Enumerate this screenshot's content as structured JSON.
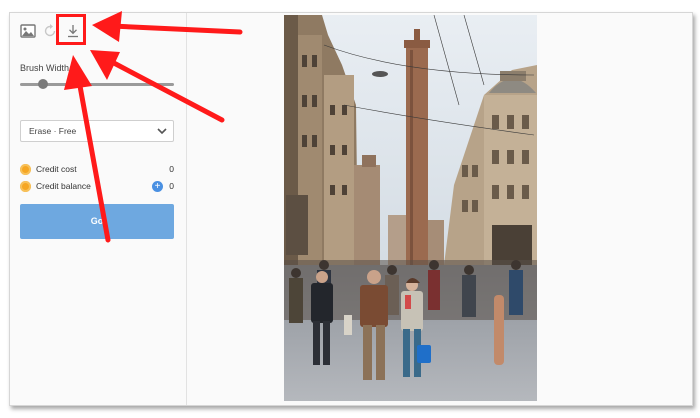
{
  "sidebar": {
    "toolbar": {
      "image_icon": "image-icon",
      "undo_icon": "rotate-icon",
      "download_icon": "download-icon"
    },
    "brush_width_label": "Brush Width",
    "brush_width_level": 0.15,
    "mode_select": {
      "value": "Erase · Free"
    },
    "credits": [
      {
        "label": "Credit cost",
        "value": "0"
      },
      {
        "label": "Credit balance",
        "value": "0"
      }
    ],
    "go_button": "Go"
  },
  "colors": {
    "accent": "#6ea8e0",
    "annotation": "#ff1a1a",
    "coin": "#f5a623",
    "plus": "#4a90e2"
  }
}
